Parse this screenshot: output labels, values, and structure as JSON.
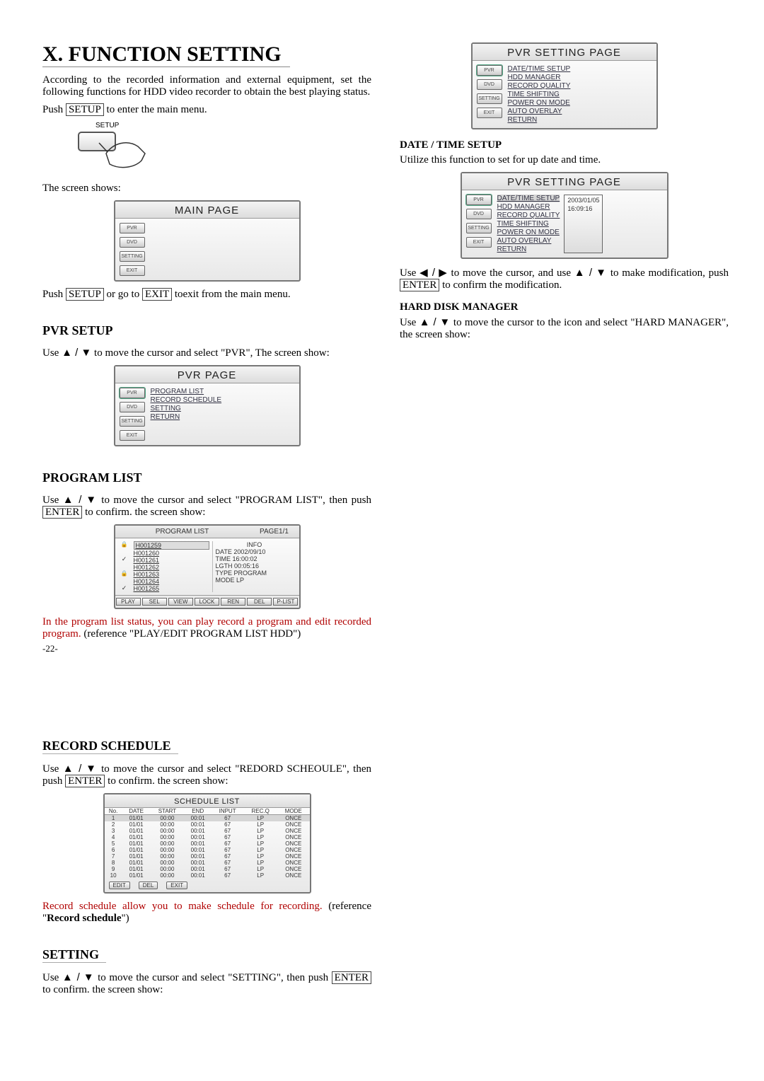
{
  "title": "X. FUNCTION SETTING",
  "intro": "According to the recorded information and external equipment, set the following functions for HDD video recorder to obtain the best playing status.",
  "push_setup_pre": "Push ",
  "push_setup_btn": "SETUP",
  "push_setup_post": " to enter the main menu.",
  "hand_label": "SETUP",
  "screen_shows": "The screen shows:",
  "main_page": {
    "title": "MAIN PAGE",
    "side": [
      "PVR",
      "DVD",
      "SETTING",
      "EXIT"
    ]
  },
  "push_exit_line": {
    "pre": "Push ",
    "b1": "SETUP",
    "mid": " or go to ",
    "b2": "EXIT",
    "post": " toexit from the main menu."
  },
  "pvr_setup_h": "PVR SETUP",
  "pvr_setup_p": {
    "pre": "Use ",
    "arrows": "▲ / ▼",
    "post": " to move the cursor and select \"PVR\", The screen show:"
  },
  "pvr_page": {
    "title": "PVR PAGE",
    "side": [
      "PVR",
      "DVD",
      "SETTING",
      "EXIT"
    ],
    "menu": [
      "PROGRAM LIST",
      "RECORD SCHEDULE",
      "SETTING",
      "RETURN"
    ]
  },
  "program_list_h": "PROGRAM LIST",
  "program_list_p": {
    "pre": "Use ",
    "arrows": "▲ / ▼",
    "mid": " to move the cursor and select \"PROGRAM LIST\", then push ",
    "btn": "ENTER",
    "post": " to confirm. the screen show:"
  },
  "program_panel": {
    "title_left": "PROGRAM LIST",
    "title_right": "PAGE1/1",
    "files": [
      "H001259",
      "H001260",
      "H001261",
      "H001262",
      "H001263",
      "H001264",
      "H001265"
    ],
    "info": {
      "h": "INFO",
      "rows": [
        "DATE 2002/09/10",
        "TIME 16:00:02",
        "LGTH 00:05:16",
        "TYPE PROGRAM",
        "MODE LP"
      ]
    },
    "foot": [
      "PLAY",
      "SEL",
      "VIEW",
      "LOCK",
      "REN",
      "DEL",
      "P-LIST"
    ]
  },
  "program_red": {
    "pre": "In the program list status, you can play record a program and edit recorded program. ",
    "ref": "(reference \"PLAY/EDIT PROGRAM LIST HDD\")"
  },
  "pagenum": "-22-",
  "record_h": "RECORD SCHEDULE",
  "record_p": {
    "pre": "Use ",
    "arrows": "▲ / ▼",
    "mid": " to move the cursor and select \"REDORD SCHEOULE\", then push ",
    "btn": "ENTER",
    "post": " to confirm. the screen show:"
  },
  "schedule": {
    "title": "SCHEDULE LIST",
    "headers": [
      "No.",
      "DATE",
      "START",
      "END",
      "INPUT",
      "REC.Q",
      "MODE"
    ],
    "rows": [
      {
        "n": "1",
        "d": "01/01",
        "s": "00:00",
        "e": "00:01",
        "i": "67",
        "q": "LP",
        "m": "ONCE"
      },
      {
        "n": "2",
        "d": "01/01",
        "s": "00:00",
        "e": "00:01",
        "i": "67",
        "q": "LP",
        "m": "ONCE"
      },
      {
        "n": "3",
        "d": "01/01",
        "s": "00:00",
        "e": "00:01",
        "i": "67",
        "q": "LP",
        "m": "ONCE"
      },
      {
        "n": "4",
        "d": "01/01",
        "s": "00:00",
        "e": "00:01",
        "i": "67",
        "q": "LP",
        "m": "ONCE"
      },
      {
        "n": "5",
        "d": "01/01",
        "s": "00:00",
        "e": "00:01",
        "i": "67",
        "q": "LP",
        "m": "ONCE"
      },
      {
        "n": "6",
        "d": "01/01",
        "s": "00:00",
        "e": "00:01",
        "i": "67",
        "q": "LP",
        "m": "ONCE"
      },
      {
        "n": "7",
        "d": "01/01",
        "s": "00:00",
        "e": "00:01",
        "i": "67",
        "q": "LP",
        "m": "ONCE"
      },
      {
        "n": "8",
        "d": "01/01",
        "s": "00:00",
        "e": "00:01",
        "i": "67",
        "q": "LP",
        "m": "ONCE"
      },
      {
        "n": "9",
        "d": "01/01",
        "s": "00:00",
        "e": "00:01",
        "i": "67",
        "q": "LP",
        "m": "ONCE"
      },
      {
        "n": "10",
        "d": "01/01",
        "s": "00:00",
        "e": "00:01",
        "i": "67",
        "q": "LP",
        "m": "ONCE"
      }
    ],
    "foot": [
      "EDIT",
      "DEL",
      "EXIT"
    ]
  },
  "record_red": {
    "pre": "Record schedule allow you to make schedule for recording. ",
    "ref": "(reference \"",
    "bold": "Record schedule",
    "post": "\")"
  },
  "setting_h": "SETTING",
  "setting_p": {
    "pre": "Use ",
    "arrows": "▲ / ▼",
    "mid": " to move the cursor and select \"SETTING\", then push ",
    "btn": "ENTER",
    "post": " to confirm. the screen show:"
  },
  "setting_page": {
    "title": "PVR SETTING PAGE",
    "side": [
      "PVR",
      "DVD",
      "SETTING",
      "EXIT"
    ],
    "menu": [
      "DATE/TIME SETUP",
      "HDD MANAGER",
      "RECORD QUALITY",
      "TIME SHIFTING",
      "POWER ON MODE",
      "AUTO OVERLAY",
      "RETURN"
    ]
  },
  "dt_h": "DATE / TIME SETUP",
  "dt_p": "Utilize this function to set for up date and time.",
  "setting_page2": {
    "title": "PVR SETTING PAGE",
    "side": [
      "PVR",
      "DVD",
      "SETTING",
      "EXIT"
    ],
    "menu": [
      "DATE/TIME SETUP",
      "HDD MANAGER",
      "RECORD QUALITY",
      "TIME SHIFTING",
      "POWER ON MODE",
      "AUTO OVERLAY",
      "RETURN"
    ],
    "date": "2003/01/05",
    "time": "16:09:16"
  },
  "dt_p2": {
    "pre": "Use ",
    "lr": "◀ / ▶",
    "mid": " to move the cursor, and use ",
    "ud": "▲ / ▼",
    "mid2": " to make modification, push ",
    "btn": "ENTER",
    "post": " to confirm the modification."
  },
  "hdm_h": "HARD DISK MANAGER",
  "hdm_p": {
    "pre": "Use ",
    "arrows": "▲ / ▼",
    "post": " to move the cursor to the icon and select \"HARD MANAGER\", the screen show:"
  }
}
